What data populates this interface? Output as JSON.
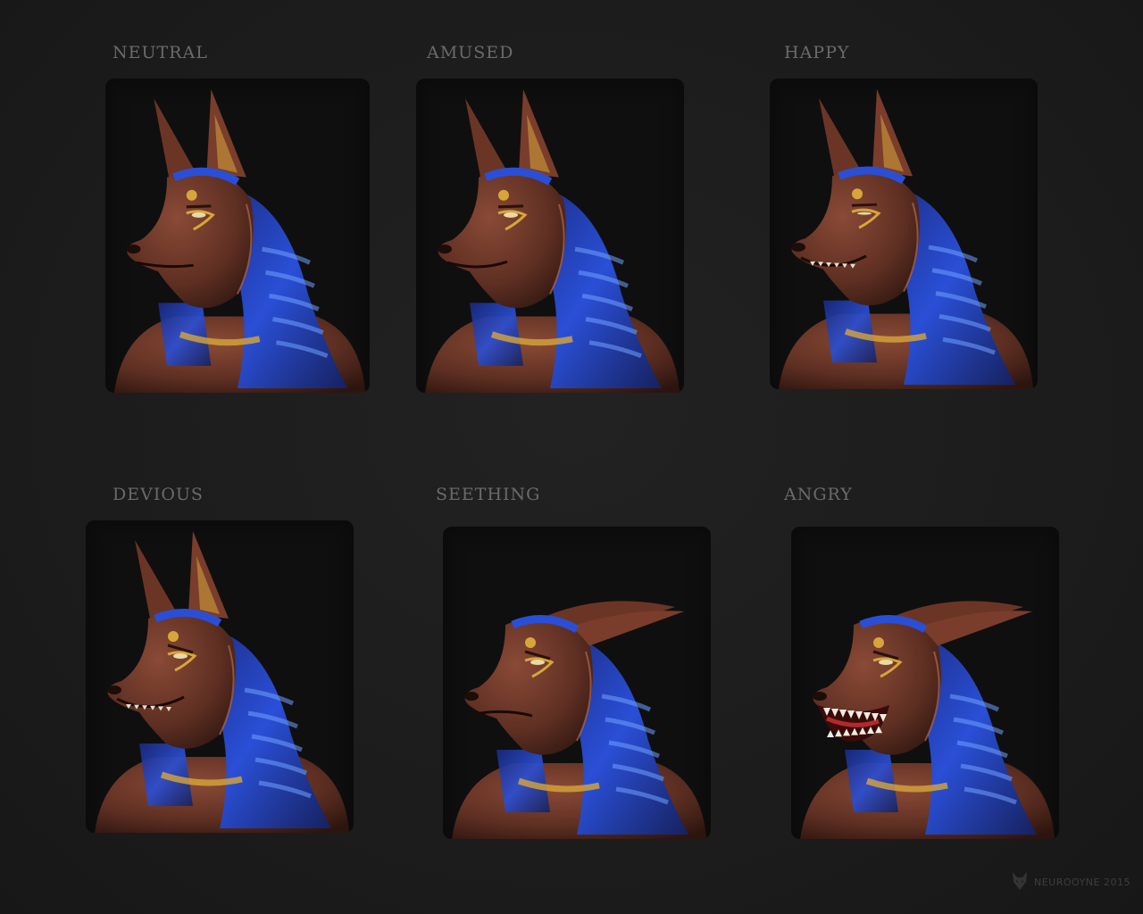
{
  "sheet": {
    "expressions": [
      {
        "label": "NEUTRAL",
        "mood": "neutral",
        "ears": "up"
      },
      {
        "label": "AMUSED",
        "mood": "amused",
        "ears": "up"
      },
      {
        "label": "HAPPY",
        "mood": "happy",
        "ears": "up"
      },
      {
        "label": "DEVIOUS",
        "mood": "devious",
        "ears": "up"
      },
      {
        "label": "SEETHING",
        "mood": "seething",
        "ears": "back"
      },
      {
        "label": "ANGRY",
        "mood": "angry",
        "ears": "back"
      }
    ]
  },
  "watermark": {
    "text": "NEUROOYNE 2015",
    "icon": "wolf-head-logo"
  },
  "palette": {
    "background": "#1c1c1c",
    "label": "#6a6a6a",
    "fur": "#5e2f22",
    "headdress_blue": "#2a4fd6",
    "gold": "#d7a63a"
  }
}
